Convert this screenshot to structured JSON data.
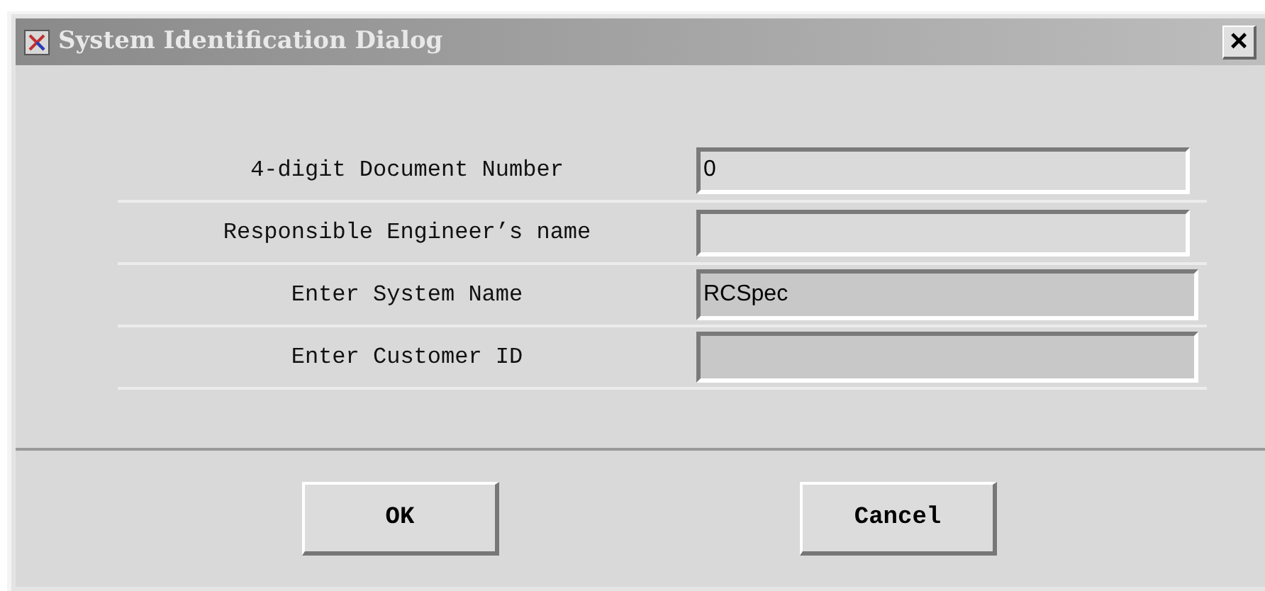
{
  "window": {
    "title": "System Identification Dialog",
    "close": "×"
  },
  "fields": [
    {
      "label": "4-digit Document Number",
      "value": "0",
      "disabled": false
    },
    {
      "label": "Responsible Engineer’s name",
      "disabled": false
    },
    {
      "label": "Enter System Name",
      "value": "RCSpec",
      "disabled": true
    },
    {
      "label": "Enter Customer ID",
      "disabled": true
    }
  ],
  "buttons": [
    "OK",
    "Cancel"
  ]
}
